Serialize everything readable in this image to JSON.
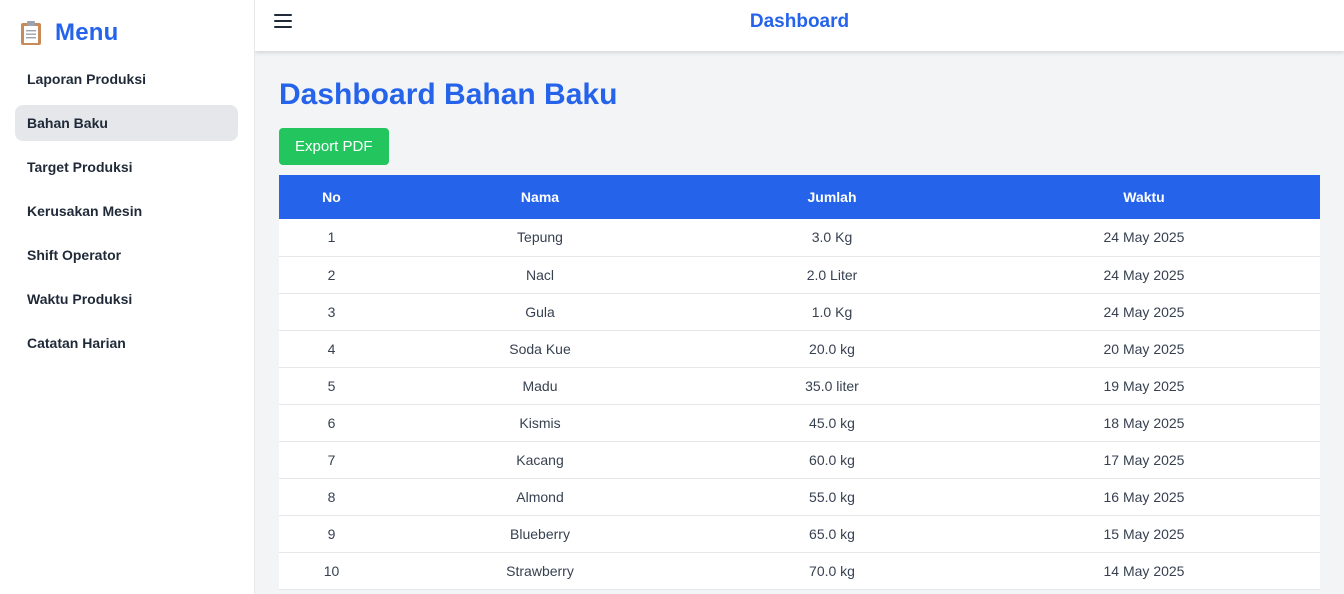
{
  "sidebar": {
    "title": "Menu",
    "icon": "clipboard-icon",
    "items": [
      {
        "label": "Laporan Produksi",
        "active": false
      },
      {
        "label": "Bahan Baku",
        "active": true
      },
      {
        "label": "Target Produksi",
        "active": false
      },
      {
        "label": "Kerusakan Mesin",
        "active": false
      },
      {
        "label": "Shift Operator",
        "active": false
      },
      {
        "label": "Waktu Produksi",
        "active": false
      },
      {
        "label": "Catatan Harian",
        "active": false
      }
    ]
  },
  "topbar": {
    "menu_icon": "hamburger-icon",
    "title": "Dashboard"
  },
  "main": {
    "page_title": "Dashboard Bahan Baku",
    "export_label": "Export PDF",
    "table": {
      "headers": [
        "No",
        "Nama",
        "Jumlah",
        "Waktu"
      ],
      "rows": [
        [
          "1",
          "Tepung",
          "3.0 Kg",
          "24 May 2025"
        ],
        [
          "2",
          "Nacl",
          "2.0 Liter",
          "24 May 2025"
        ],
        [
          "3",
          "Gula",
          "1.0 Kg",
          "24 May 2025"
        ],
        [
          "4",
          "Soda Kue",
          "20.0 kg",
          "20 May 2025"
        ],
        [
          "5",
          "Madu",
          "35.0 liter",
          "19 May 2025"
        ],
        [
          "6",
          "Kismis",
          "45.0 kg",
          "18 May 2025"
        ],
        [
          "7",
          "Kacang",
          "60.0 kg",
          "17 May 2025"
        ],
        [
          "8",
          "Almond",
          "55.0 kg",
          "16 May 2025"
        ],
        [
          "9",
          "Blueberry",
          "65.0 kg",
          "15 May 2025"
        ],
        [
          "10",
          "Strawberry",
          "70.0 kg",
          "14 May 2025"
        ]
      ]
    }
  },
  "colors": {
    "accent": "#2563eb",
    "export_button": "#22c55e",
    "active_item": "#e5e7eb",
    "content_bg": "#f3f4f6"
  }
}
